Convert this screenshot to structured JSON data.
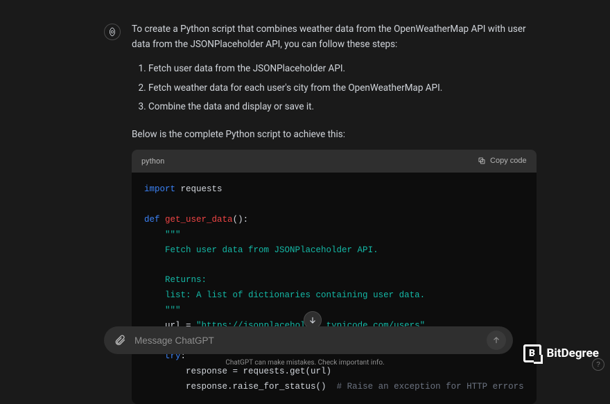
{
  "message": {
    "intro": "To create a Python script that combines weather data from the OpenWeatherMap API with user data from the JSONPlaceholder API, you can follow these steps:",
    "steps": [
      "Fetch user data from the JSONPlaceholder API.",
      "Fetch weather data for each user's city from the OpenWeatherMap API.",
      "Combine the data and display or save it."
    ],
    "subheading": "Below is the complete Python script to achieve this:"
  },
  "code": {
    "lang": "python",
    "copy_label": "Copy code",
    "tokens": {
      "import": "import",
      "requests": "requests",
      "def": "def",
      "func_name": "get_user_data",
      "parens": "()",
      "colon": ":",
      "triple_quote": "\"\"\"",
      "docline1": "Fetch user data from JSONPlaceholder API.",
      "returns": "Returns:",
      "docline2": "list: A list of dictionaries containing user data.",
      "url_var": "url",
      "equals": " = ",
      "url_str": "\"https://jsonplaceholder.typicode.com/users\"",
      "try": "try",
      "response": "response",
      "assign_call": " = requests.get(url)",
      "raise_call": "response.raise_for_status()",
      "comment": "# Raise an exception for HTTP errors"
    }
  },
  "input": {
    "placeholder": "Message ChatGPT"
  },
  "footer": {
    "disclaimer": "ChatGPT can make mistakes. Check important info."
  },
  "brand": {
    "name": "BitDegree",
    "initial": "B"
  },
  "help": {
    "label": "?"
  }
}
